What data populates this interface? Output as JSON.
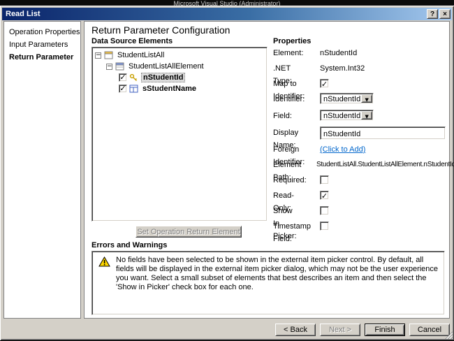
{
  "background_window": {
    "title": "Microsoft Visual Studio (Administrator)"
  },
  "icons": {
    "help": "?",
    "close": "×",
    "dropdown": "▼",
    "collapse": "−"
  },
  "dialog": {
    "title": "Read List"
  },
  "sidebar": {
    "items": [
      {
        "label": "Operation Properties"
      },
      {
        "label": "Input Parameters"
      },
      {
        "label": "Return Parameter"
      }
    ]
  },
  "main": {
    "heading": "Return Parameter Configuration",
    "data_source_label": "Data Source Elements",
    "tree": {
      "root": "StudentListAll",
      "element": "StudentListAllElement",
      "fields": [
        {
          "label": "nStudentId",
          "check": "✓"
        },
        {
          "label": "sStudentName",
          "check": "✓"
        }
      ]
    },
    "set_return_button": "Set Operation Return Element",
    "properties_label": "Properties",
    "properties": {
      "element_label": "Element:",
      "element_value": "nStudentId",
      "net_type_label": ".NET Type:",
      "net_type_value": "System.Int32",
      "map_identifier_label": "Map to Identifier:",
      "map_identifier_check": "✓",
      "identifier_label": "Identifier:",
      "identifier_value": "nStudentId",
      "field_label": "Field:",
      "field_value": "nStudentId",
      "display_name_label": "Display Name:",
      "display_name_value": "nStudentId",
      "foreign_identifier_label": "Foreign Identifier:",
      "foreign_identifier_link": "(Click to Add)",
      "element_path_label": "Element Path:",
      "element_path_value": "StudentListAll.StudentListAllElement.nStudentId",
      "required_label": "Required:",
      "required_check": "",
      "read_only_label": "Read-Only:",
      "read_only_check": "✓",
      "show_in_picker_label": "Show In Picker:",
      "show_in_picker_check": "",
      "timestamp_label": "Timestamp Field:",
      "timestamp_check": ""
    },
    "errors_label": "Errors and Warnings",
    "warning_message": "No fields have been selected to be shown in the external item picker control. By default, all fields will be displayed in the external item picker dialog, which may not be the user experience you want. Select a small subset of elements that best describes an item and then select the 'Show in Picker' check box for each one."
  },
  "footer": {
    "back": "< Back",
    "next": "Next >",
    "finish": "Finish",
    "cancel": "Cancel"
  }
}
